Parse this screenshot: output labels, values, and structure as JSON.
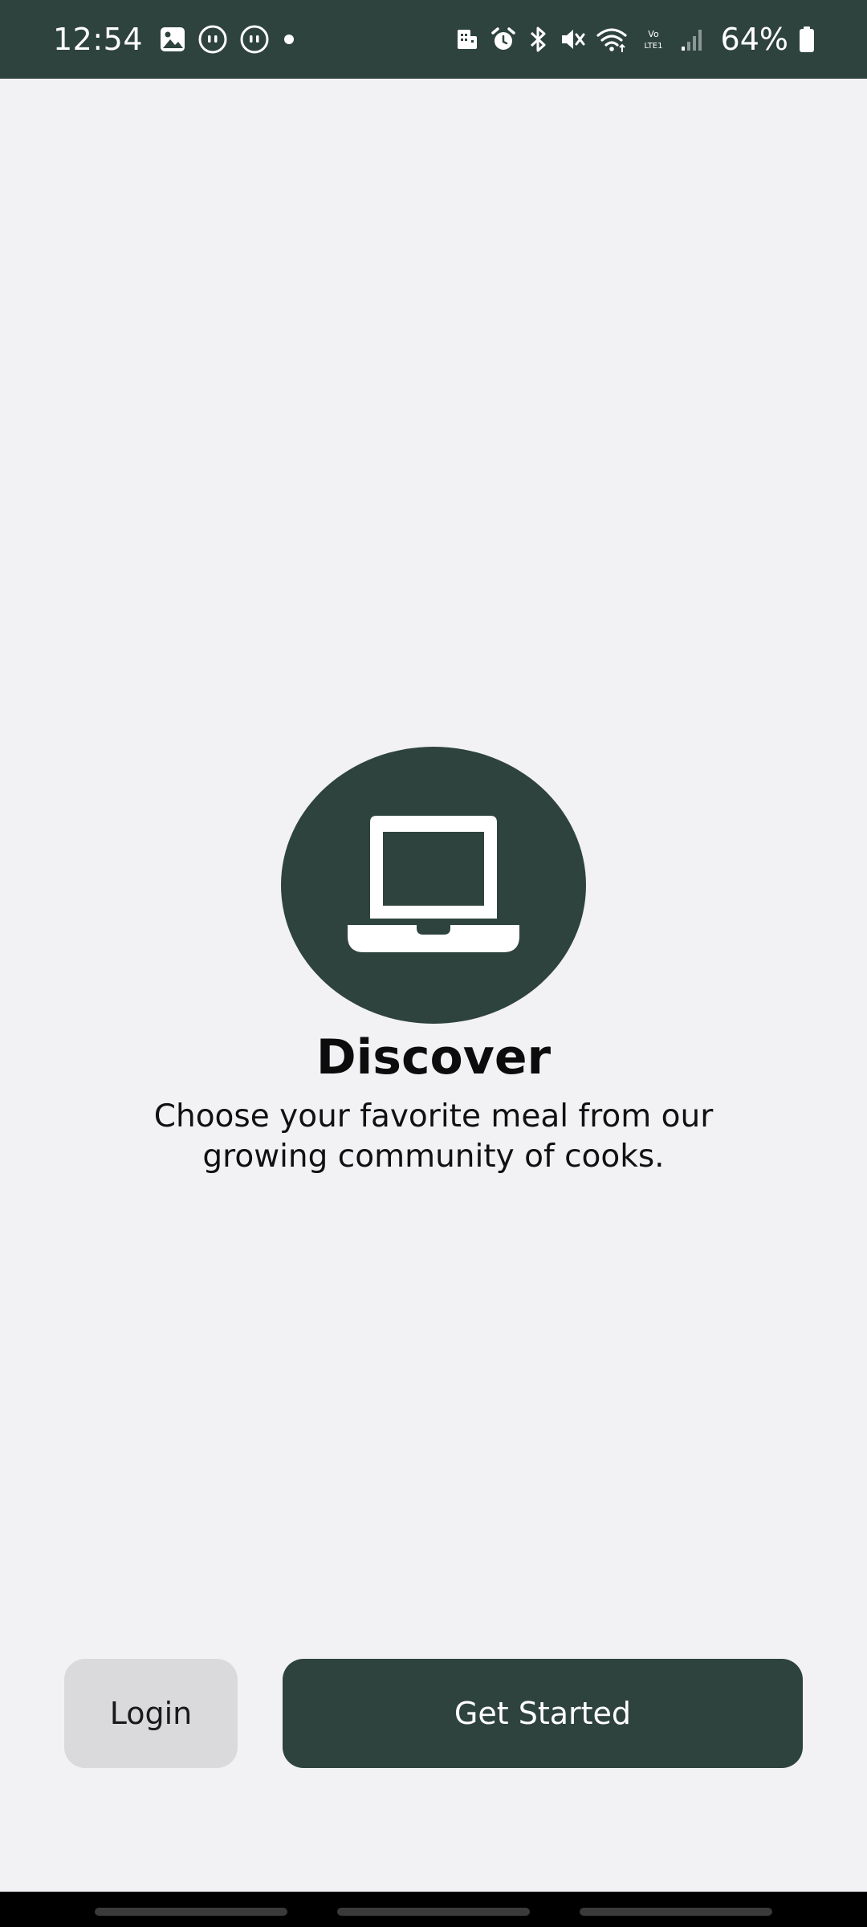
{
  "status_bar": {
    "time": "12:54",
    "battery_percent": "64%",
    "network_label": "Vo LTE1",
    "left_icons": [
      "gallery-icon",
      "chat-bubble-icon",
      "chat-bubble-icon",
      "dot-icon"
    ],
    "right_icons": [
      "building-icon",
      "alarm-icon",
      "bluetooth-icon",
      "mute-icon",
      "wifi-icon",
      "volte-icon",
      "signal-icon",
      "battery-icon"
    ],
    "bar_color": "#2e433e"
  },
  "hero": {
    "icon": "laptop-icon",
    "circle_color": "#2e433e",
    "title": "Discover",
    "subtitle": "Choose your favorite meal from our growing community of cooks."
  },
  "actions": {
    "login_label": "Login",
    "get_started_label": "Get Started",
    "primary_color": "#2e433e",
    "secondary_color": "#dad9dc"
  },
  "colors": {
    "background": "#f2f1f4"
  }
}
